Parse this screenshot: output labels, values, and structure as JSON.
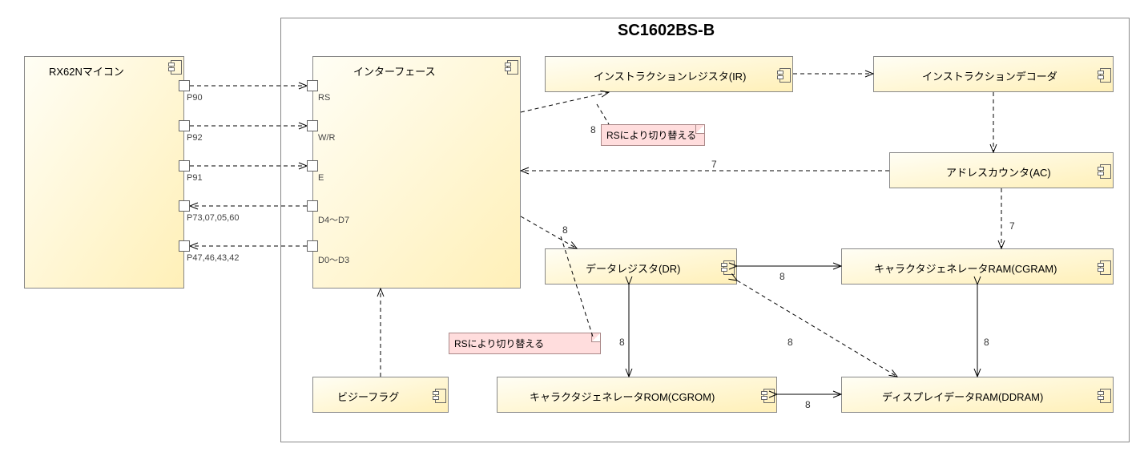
{
  "container": {
    "title": "SC1602BS-B"
  },
  "mcu": {
    "label": "RX62Nマイコン",
    "ports": {
      "p90": "P90",
      "p92": "P92",
      "p91": "P91",
      "p73": "P73,07,05,60",
      "p47": "P47,46,43,42"
    }
  },
  "interface": {
    "label": "インターフェース",
    "ports": {
      "rs": "RS",
      "wr": "W/R",
      "e": "E",
      "d47": "D4～D7",
      "d03": "D0～D3"
    }
  },
  "ir": {
    "label": "インストラクションレジスタ(IR)"
  },
  "decoder": {
    "label": "インストラクションデコーダ"
  },
  "ac": {
    "label": "アドレスカウンタ(AC)"
  },
  "dr": {
    "label": "データレジスタ(DR)"
  },
  "cgram": {
    "label": "キャラクタジェネレータRAM(CGRAM)"
  },
  "ddram": {
    "label": "ディスプレイデータRAM(DDRAM)"
  },
  "cgrom": {
    "label": "キャラクタジェネレータROM(CGROM)"
  },
  "busy": {
    "label": "ビジーフラグ"
  },
  "notes": {
    "rs1": "RSにより切り替える",
    "rs2": "RSにより切り替える"
  },
  "edge_labels": {
    "e1": "8",
    "e2": "7",
    "e3": "8",
    "e4": "8",
    "e5": "8",
    "e6": "8",
    "e7": "8",
    "e8": "7",
    "e9": "8"
  }
}
